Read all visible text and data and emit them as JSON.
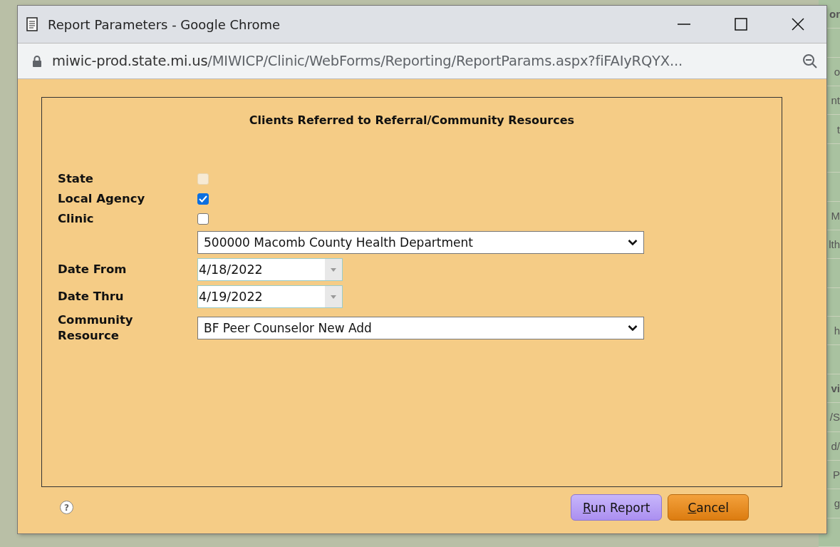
{
  "background_fragments": [
    "or",
    "o",
    "nt",
    "t",
    "M",
    "lth",
    "h",
    "vi",
    "/S",
    "d/",
    "P",
    "g"
  ],
  "window": {
    "title": "Report Parameters - Google Chrome",
    "url": "miwic-prod.state.mi.us/MIWICP/Clinic/WebForms/Reporting/ReportParams.aspx?fiFAIyRQYX..."
  },
  "report": {
    "title": "Clients Referred to Referral/Community Resources",
    "fields": [
      {
        "kind": "checkbox",
        "label": "State",
        "checked": false,
        "disabled": true
      },
      {
        "kind": "checkbox",
        "label": "Local Agency",
        "checked": true,
        "disabled": false
      },
      {
        "kind": "checkbox",
        "label": "Clinic",
        "checked": false,
        "disabled": false
      },
      {
        "kind": "select",
        "value": "500000 Macomb County Health Department"
      },
      {
        "kind": "date",
        "label": "Date From",
        "value": "4/18/2022"
      },
      {
        "kind": "date",
        "label": "Date Thru",
        "value": "4/19/2022"
      },
      {
        "kind": "select",
        "label": "Community Resource",
        "value": "BF Peer Counselor New Add"
      }
    ]
  },
  "help": {
    "symbol": "?"
  },
  "buttons": [
    {
      "label": "Run Report",
      "kind": "primary"
    },
    {
      "label": "Cancel",
      "kind": "cancel"
    }
  ]
}
